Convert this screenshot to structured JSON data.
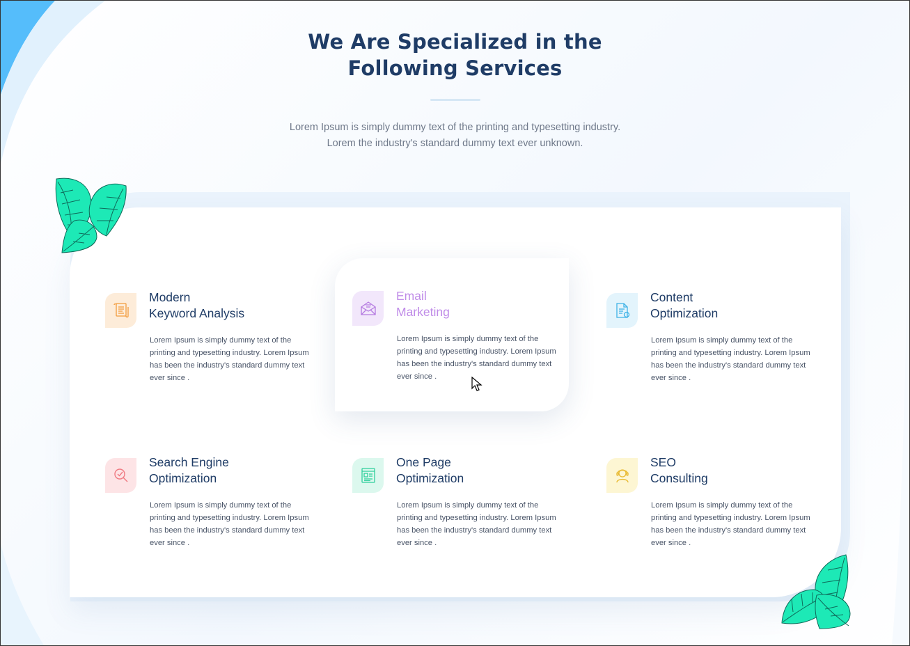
{
  "header": {
    "title_line1": "We Are Specialized in the",
    "title_line2": "Following Services",
    "subtitle_line1": "Lorem Ipsum is simply dummy text of the printing and typesetting industry.",
    "subtitle_line2": "Lorem the industry's standard dummy text ever unknown."
  },
  "colors": {
    "heading": "#1f3c66",
    "body_text": "#6e7889",
    "accent_blue": "#4db8ff",
    "leaf_green": "#1de9b6",
    "email_purple": "#c08ce8"
  },
  "services": [
    {
      "title_line1": "Modern",
      "title_line2": "Keyword Analysis",
      "desc": "Lorem Ipsum is simply dummy text of the printing and typesetting industry. Lorem Ipsum has been the industry's standard dummy text ever since .",
      "icon": "scroll-icon",
      "icon_color": "#f39c3d",
      "icon_bg": "#fdecd9"
    },
    {
      "title_line1": "Email",
      "title_line2": "Marketing",
      "desc": "Lorem Ipsum is simply dummy text of the printing and typesetting industry. Lorem Ipsum has been the industry's standard dummy text ever since .",
      "icon": "envelope-icon",
      "icon_color": "#b57be0",
      "icon_bg": "#f2e7fb"
    },
    {
      "title_line1": "Content",
      "title_line2": "Optimization",
      "desc": "Lorem Ipsum is simply dummy text of the printing and typesetting industry. Lorem Ipsum has been the industry's standard dummy text ever since .",
      "icon": "document-icon",
      "icon_color": "#3fb2e6",
      "icon_bg": "#e3f4fc"
    },
    {
      "title_line1": "Search Engine",
      "title_line2": "Optimization",
      "desc": "Lorem Ipsum is simply dummy text of the printing and typesetting industry. Lorem Ipsum has been the industry's standard dummy text ever since .",
      "icon": "magnifier-icon",
      "icon_color": "#f07a82",
      "icon_bg": "#fde4e6"
    },
    {
      "title_line1": "One Page",
      "title_line2": "Optimization",
      "desc": "Lorem Ipsum is simply dummy text of the printing and typesetting industry. Lorem Ipsum has been the industry's standard dummy text ever since .",
      "icon": "webpage-icon",
      "icon_color": "#2ecf9c",
      "icon_bg": "#dcf8ee"
    },
    {
      "title_line1": "SEO",
      "title_line2": "Consulting",
      "desc": "Lorem Ipsum is simply dummy text of the printing and typesetting industry. Lorem Ipsum has been the industry's standard dummy text ever since .",
      "icon": "consultant-icon",
      "icon_color": "#e8b92f",
      "icon_bg": "#fdf6d3"
    }
  ]
}
